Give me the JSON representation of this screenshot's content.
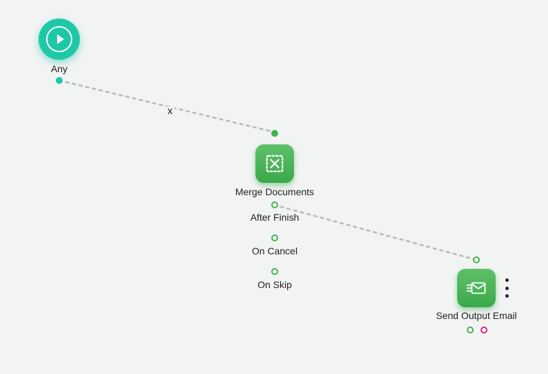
{
  "colors": {
    "teal": "#1ec8a7",
    "green": "#3bb54a",
    "magenta": "#e41e8e",
    "connector": "#b8b8b8"
  },
  "nodes": {
    "start": {
      "label": "Any",
      "type": "trigger"
    },
    "merge": {
      "label": "Merge Documents",
      "type": "action",
      "outputs": {
        "after_finish": "After Finish",
        "on_cancel": "On Cancel",
        "on_skip": "On Skip"
      }
    },
    "email": {
      "label": "Send Output Email",
      "type": "action"
    }
  },
  "edge_delete_symbol": "x"
}
